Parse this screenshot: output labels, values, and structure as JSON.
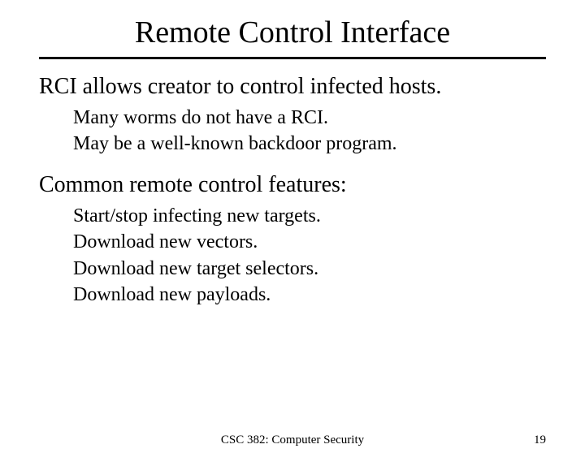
{
  "title": "Remote Control Interface",
  "section1": {
    "heading": "RCI allows creator to control infected hosts.",
    "items": [
      "Many worms do not have a RCI.",
      "May be a well-known backdoor program."
    ]
  },
  "section2": {
    "heading": "Common remote control features:",
    "items": [
      "Start/stop infecting new targets.",
      "Download new vectors.",
      "Download new target selectors.",
      "Download new payloads."
    ]
  },
  "footer": {
    "course": "CSC 382: Computer Security",
    "page": "19"
  }
}
